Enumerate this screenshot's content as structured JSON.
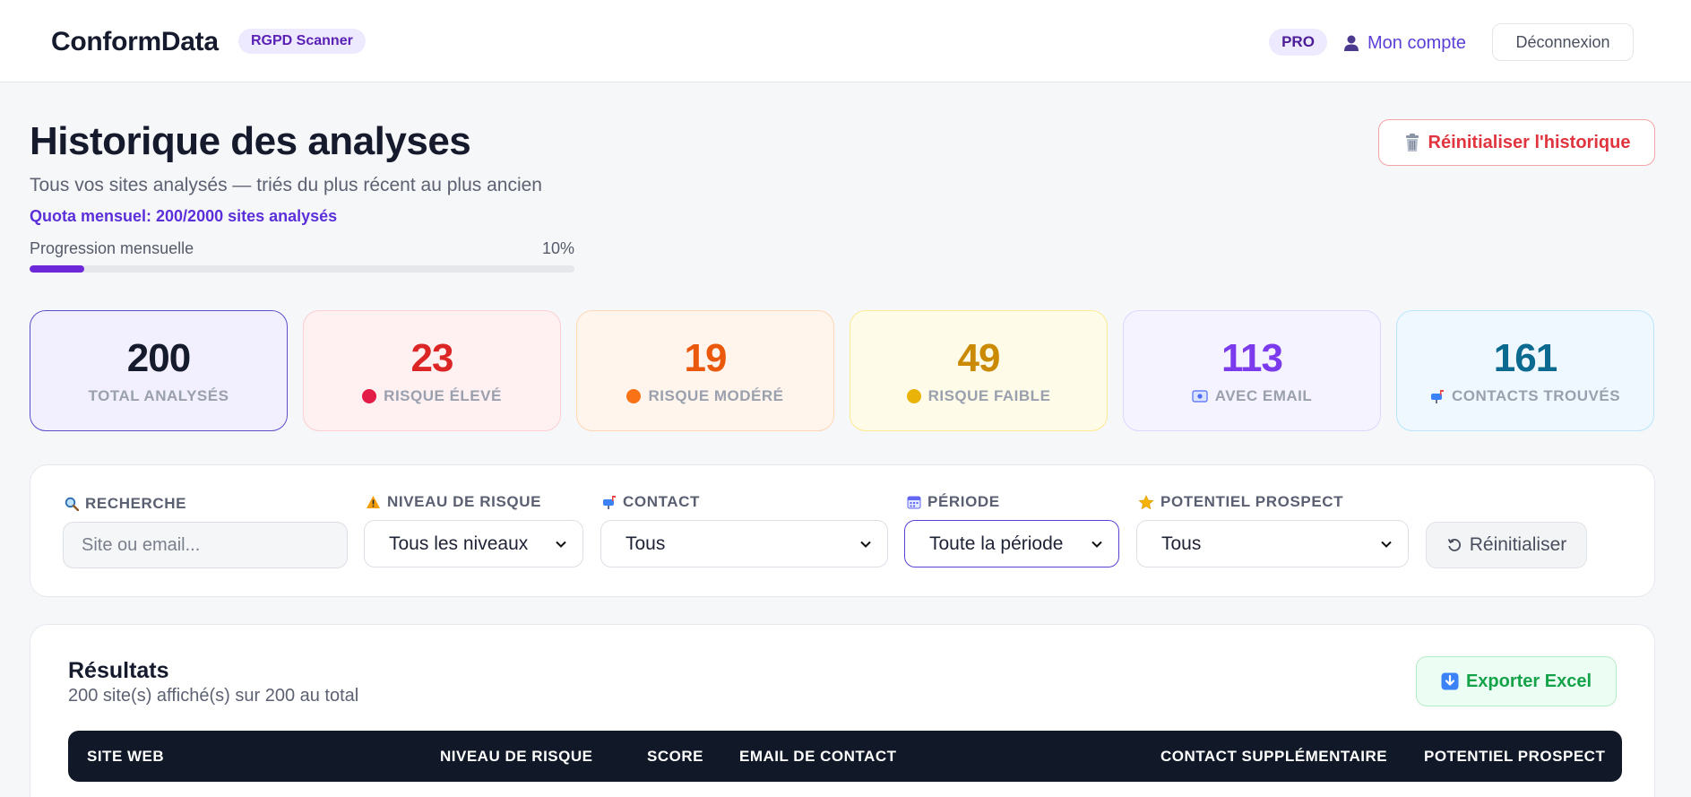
{
  "header": {
    "brand": "ConformData",
    "brand_badge": "RGPD Scanner",
    "plan_badge": "PRO",
    "account_label": "Mon compte",
    "account_icon": "user-icon",
    "logout_label": "Déconnexion"
  },
  "page": {
    "title": "Historique des analyses",
    "subtitle": "Tous vos sites analysés — triés du plus récent au plus ancien",
    "quota": "Quota mensuel: 200/2000 sites analysés",
    "progress_label": "Progression mensuelle",
    "progress_text": "10%",
    "progress_fraction": 0.1,
    "reset_history_label": "Réinitialiser l'historique",
    "reset_history_icon": "trash-icon"
  },
  "stats": [
    {
      "value": "200",
      "label": "TOTAL ANALYSÉS",
      "color": "#151a2d",
      "bg": "#f2f0ff",
      "border": "#5b4fc9"
    },
    {
      "value": "23",
      "label": "RISQUE ÉLEVÉ",
      "color": "#dc2626",
      "bg": "#fff1f2",
      "border": "#fbcfd3",
      "icon": "red-circle-icon",
      "icon_color": "#e11d48"
    },
    {
      "value": "19",
      "label": "RISQUE MODÉRÉ",
      "color": "#ea580c",
      "bg": "#fff5ed",
      "border": "#fed7b5",
      "icon": "orange-circle-icon",
      "icon_color": "#f97316"
    },
    {
      "value": "49",
      "label": "RISQUE FAIBLE",
      "color": "#ca8a04",
      "bg": "#fefbe8",
      "border": "#fdeb93",
      "icon": "yellow-circle-icon",
      "icon_color": "#eab308"
    },
    {
      "value": "113",
      "label": "AVEC EMAIL",
      "color": "#7c3aed",
      "bg": "#f5f3ff",
      "border": "#ddd6fe",
      "icon": "email-icon",
      "icon_color": "#4f6cf7"
    },
    {
      "value": "161",
      "label": "CONTACTS TROUVÉS",
      "color": "#0b6a8f",
      "bg": "#eff8ff",
      "border": "#bae6fd",
      "icon": "mailbox-icon",
      "icon_color": "#2563eb"
    }
  ],
  "filters": {
    "search": {
      "label": "RECHERCHE",
      "placeholder": "Site ou email...",
      "icon": "magnifier-icon"
    },
    "risk": {
      "label": "NIVEAU DE RISQUE",
      "value": "Tous les niveaux",
      "icon": "warning-icon"
    },
    "contact": {
      "label": "CONTACT",
      "value": "Tous",
      "icon": "mailbox-icon"
    },
    "period": {
      "label": "PÉRIODE",
      "value": "Toute la période",
      "icon": "calendar-icon"
    },
    "prospect": {
      "label": "POTENTIEL PROSPECT",
      "value": "Tous",
      "icon": "star-icon"
    },
    "reset_label": "Réinitialiser",
    "reset_icon": "refresh-icon"
  },
  "results": {
    "title": "Résultats",
    "count": "200 site(s) affiché(s) sur 200 au total",
    "export_label": "Exporter Excel",
    "export_icon": "download-icon",
    "columns": [
      "SITE WEB",
      "NIVEAU DE RISQUE",
      "SCORE",
      "EMAIL DE CONTACT",
      "CONTACT SUPPLÉMENTAIRE",
      "POTENTIEL PROSPECT"
    ]
  }
}
